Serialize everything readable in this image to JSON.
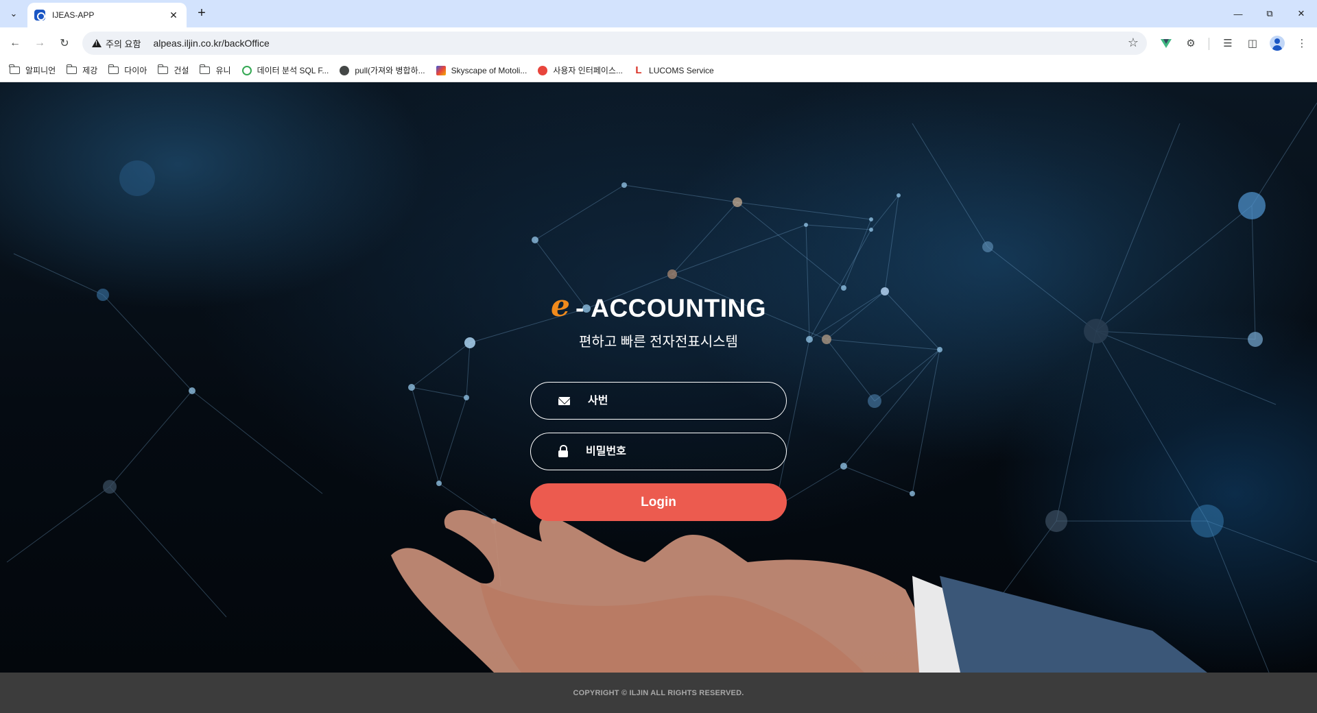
{
  "browser": {
    "tab": {
      "title": "IJEAS-APP"
    },
    "address": {
      "security_label": "주의 요함",
      "url": "alpeas.iljin.co.kr/backOffice"
    }
  },
  "bookmarks": [
    {
      "label": "알피니언",
      "icon": "folder-icon"
    },
    {
      "label": "제강",
      "icon": "folder-icon"
    },
    {
      "label": "다이아",
      "icon": "folder-icon"
    },
    {
      "label": "건설",
      "icon": "folder-icon"
    },
    {
      "label": "유니",
      "icon": "folder-icon"
    },
    {
      "label": "데이터 분석 SQL F...",
      "icon": "green-favicon",
      "color": "#34a853"
    },
    {
      "label": "pull(가져와 병합하...",
      "icon": "globe-favicon",
      "color": "#444746"
    },
    {
      "label": "Skyscape of Motoli...",
      "icon": "pencil-favicon",
      "color": "#3b5bdb"
    },
    {
      "label": "사용자 인터페이스...",
      "icon": "red-favicon",
      "color": "#e8453c"
    },
    {
      "label": "LUCOMS Service",
      "icon": "lucoms-favicon",
      "color": "#d93025"
    }
  ],
  "app": {
    "brand_e": "e",
    "brand_text": "- ACCOUNTING",
    "subtitle": "편하고 빠른 전자전표시스템",
    "employee_placeholder": "사번",
    "password_placeholder": "비밀번호",
    "login_label": "Login",
    "footer": "COPYRIGHT © ILJIN ALL RIGHTS RESERVED.",
    "accent_color": "#ec5b4f",
    "brand_color": "#f08a1c"
  }
}
